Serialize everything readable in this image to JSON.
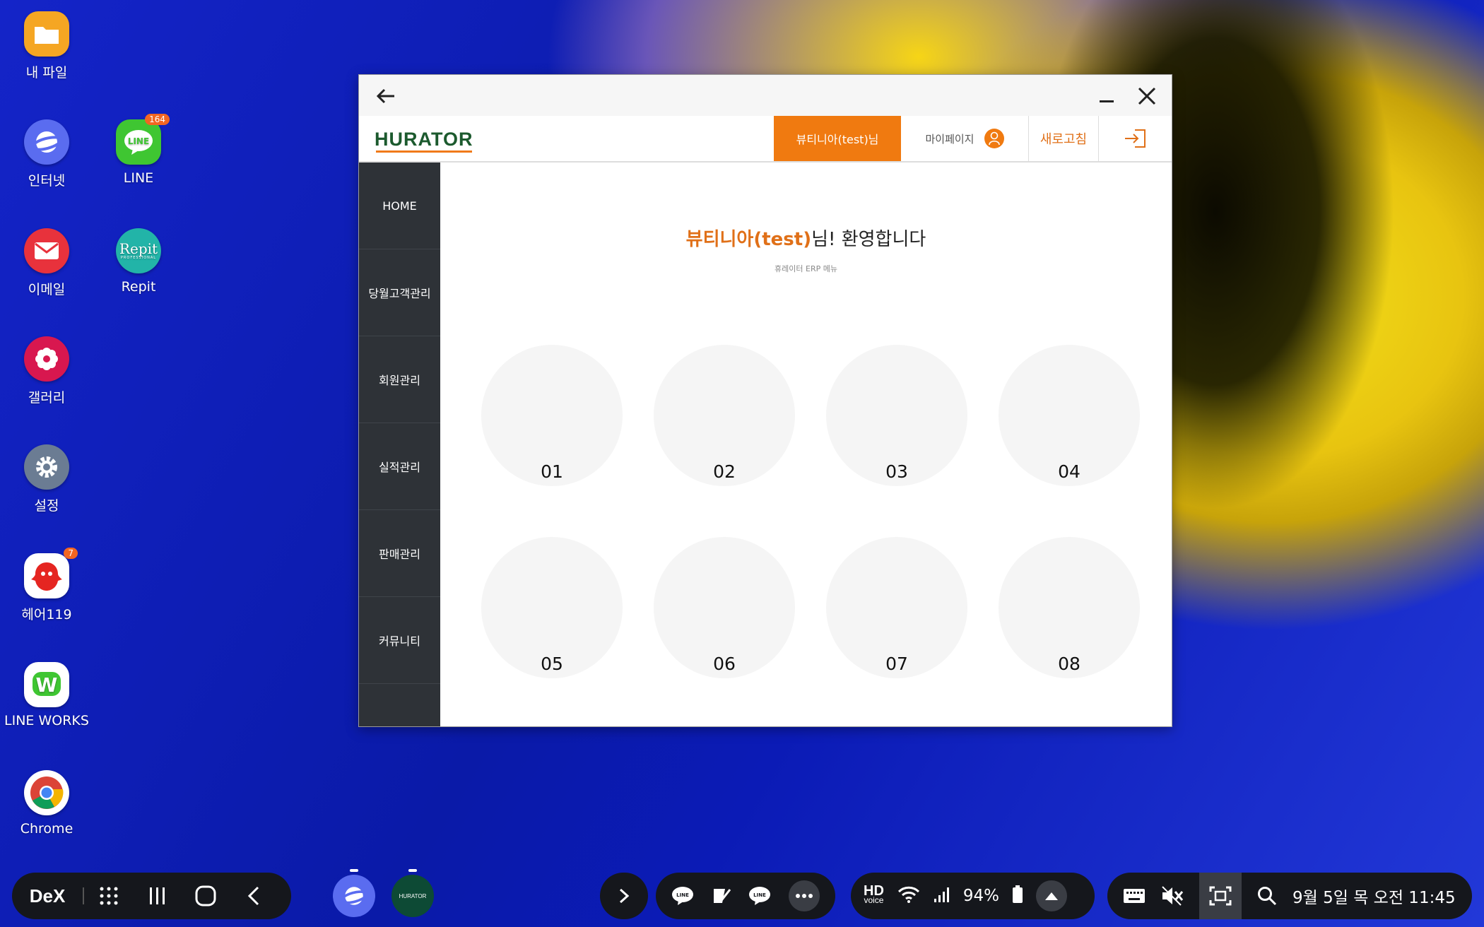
{
  "desktop": {
    "icons": [
      {
        "label": "내 파일",
        "name": "my-files"
      },
      {
        "label": "인터넷",
        "name": "internet"
      },
      {
        "label": "LINE",
        "name": "line",
        "badge": "164"
      },
      {
        "label": "이메일",
        "name": "email"
      },
      {
        "label": "Repit",
        "name": "repit",
        "logo_text": "Repit",
        "logo_sub": "PROFESSIONAL"
      },
      {
        "label": "갤러리",
        "name": "gallery"
      },
      {
        "label": "설정",
        "name": "settings"
      },
      {
        "label": "헤어119",
        "name": "hair119",
        "badge": "7"
      },
      {
        "label": "LINE WORKS",
        "name": "line-works"
      },
      {
        "label": "Chrome",
        "name": "chrome"
      }
    ]
  },
  "window": {
    "app": {
      "logo": "HURATOR",
      "user_label": "뷰티니아(test)님",
      "mypage_label": "마이페이지",
      "refresh_label": "새로고침"
    },
    "sidebar": {
      "items": [
        {
          "label": "HOME"
        },
        {
          "label": "당월고객관리"
        },
        {
          "label": "회원관리"
        },
        {
          "label": "실적관리"
        },
        {
          "label": "판매관리"
        },
        {
          "label": "커뮤니티"
        }
      ]
    },
    "main": {
      "welcome_name": "뷰티니아(test)",
      "welcome_rest": "님! 환영합니다",
      "subtitle": "휴레이터 ERP 메뉴",
      "menu": [
        {
          "label": "01"
        },
        {
          "label": "02"
        },
        {
          "label": "03"
        },
        {
          "label": "04"
        },
        {
          "label": "05"
        },
        {
          "label": "06"
        },
        {
          "label": "07"
        },
        {
          "label": "08"
        }
      ]
    }
  },
  "taskbar": {
    "dex_label": "DeX",
    "running_app_label": "HURATOR",
    "quick_line1": "LINE",
    "quick_line2": "LINE",
    "hd_label": "HD",
    "voice_label": "voice",
    "battery": "94%",
    "datetime": "9월 5일 목 오전 11:45"
  },
  "colors": {
    "accent": "#f07a10",
    "logo_green": "#1c5a2e",
    "sidebar_bg": "#2e3237",
    "circle_bg": "#f5f5f5"
  }
}
